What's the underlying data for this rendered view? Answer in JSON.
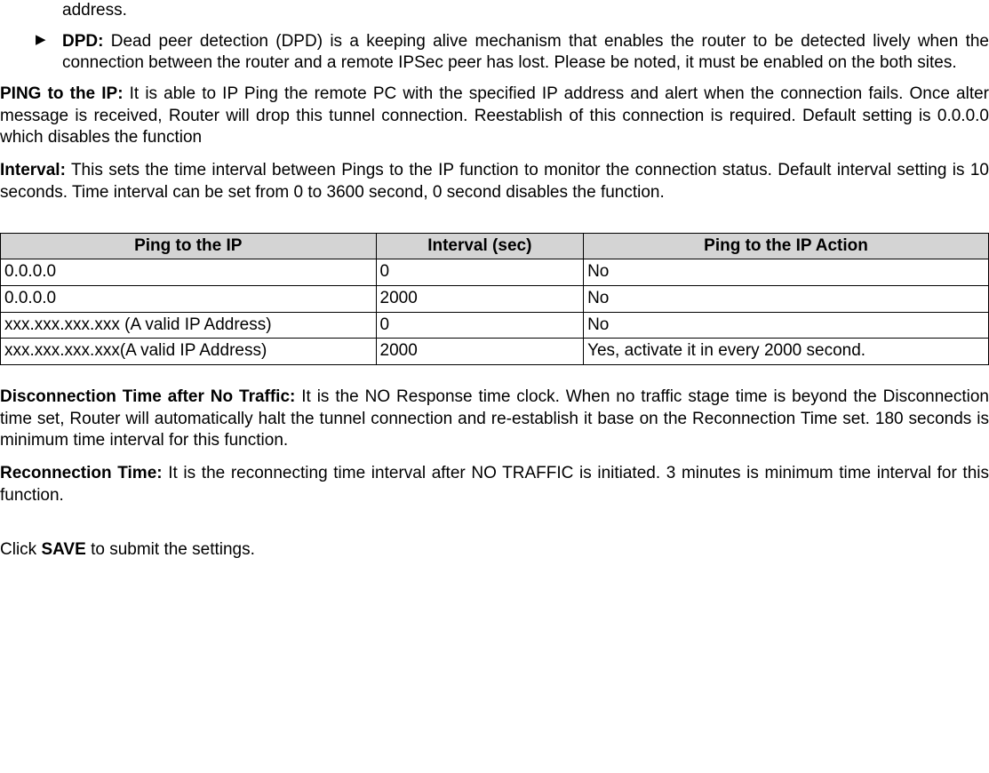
{
  "frag_address": "address.",
  "bullet": {
    "label": "DPD:",
    "text": " Dead peer detection (DPD) is a keeping alive mechanism that enables the router to be detected lively when the connection between the router and a remote IPSec peer has lost. Please be noted, it must be enabled on the both sites."
  },
  "ping_ip": {
    "label": "PING to the IP:",
    "text": " It is able to IP Ping the remote PC with the specified IP address and alert when the connection fails. Once alter message is received, Router will drop this tunnel connection. Reestablish of this connection is required. Default setting is 0.0.0.0 which disables the function"
  },
  "interval": {
    "label": "Interval:",
    "text": " This sets the time interval between Pings to the IP function to monitor the connection status. Default interval setting is 10 seconds. Time interval can be set from 0 to 3600 second, 0 second disables the function."
  },
  "chart_data": {
    "type": "table",
    "columns": [
      "Ping to the IP",
      "Interval (sec)",
      "Ping to the IP Action"
    ],
    "rows": [
      [
        "0.0.0.0",
        "0",
        "No"
      ],
      [
        "0.0.0.0",
        "2000",
        "No"
      ],
      [
        "xxx.xxx.xxx.xxx (A valid IP Address)",
        "0",
        "No"
      ],
      [
        "xxx.xxx.xxx.xxx(A valid IP Address)",
        "2000",
        "Yes, activate it in every 2000 second."
      ]
    ]
  },
  "disc_time": {
    "label": "Disconnection Time after No Traffic:",
    "text": " It is the NO Response time clock. When no traffic stage time is beyond the Disconnection time set, Router will automatically halt the tunnel connection and re-establish it base on the Reconnection Time set. 180 seconds is minimum time interval for this function."
  },
  "reconn_time": {
    "label": "Reconnection Time:",
    "text": " It is the reconnecting time interval after NO TRAFFIC is initiated. 3 minutes is minimum time interval for this function."
  },
  "save_line": {
    "prefix": "Click ",
    "bold": "SAVE",
    "suffix": " to submit the settings."
  }
}
